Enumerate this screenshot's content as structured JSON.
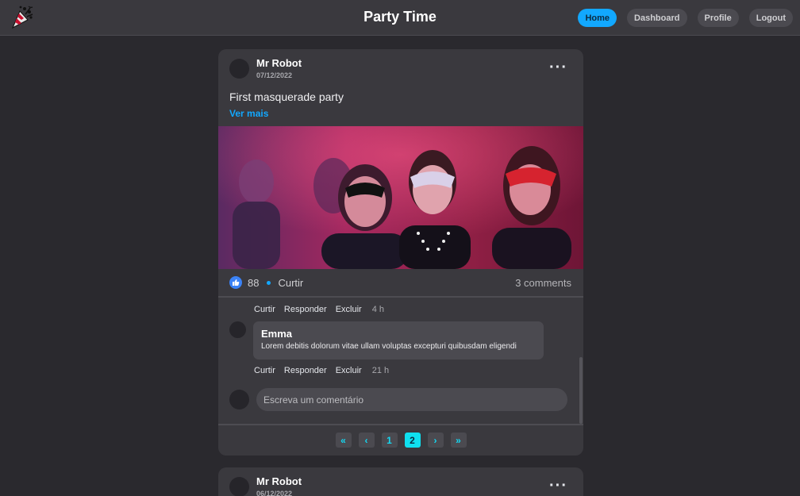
{
  "header": {
    "title": "Party Time",
    "logo_icon": "party-popper-icon",
    "nav": [
      {
        "label": "Home",
        "active": true
      },
      {
        "label": "Dashboard",
        "active": false
      },
      {
        "label": "Profile",
        "active": false
      },
      {
        "label": "Logout",
        "active": false
      }
    ]
  },
  "posts": [
    {
      "author": "Mr Robot",
      "date": "07/12/2022",
      "menu_icon": "more-horizontal-icon",
      "text": "First masquerade party",
      "see_more": "Ver mais",
      "image_icon": "masquerade-party-photo",
      "likes": "88",
      "like_label": "Curtir",
      "comments_count": "3 comments",
      "comments": [
        {
          "name": "",
          "text": "",
          "actions": {
            "like": "Curtir",
            "reply": "Responder",
            "delete": "Excluir",
            "time": "4 h"
          }
        },
        {
          "name": "Emma",
          "text": "Lorem debitis dolorum vitae ullam voluptas excepturi quibusdam eligendi",
          "actions": {
            "like": "Curtir",
            "reply": "Responder",
            "delete": "Excluir",
            "time": "21 h"
          }
        }
      ],
      "comment_placeholder": "Escreva um comentário",
      "pagination": {
        "first": "«",
        "prev": "‹",
        "pages": [
          "1",
          "2"
        ],
        "current_page": "2",
        "next": "›",
        "last": "»"
      }
    },
    {
      "author": "Mr Robot",
      "date": "06/12/2022",
      "menu_icon": "more-horizontal-icon"
    }
  ],
  "colors": {
    "background": "#2a292e",
    "card": "#3a393e",
    "accent": "#12a8ff",
    "page_accent": "#0fe0f0",
    "like_blue": "#3b82f6"
  }
}
